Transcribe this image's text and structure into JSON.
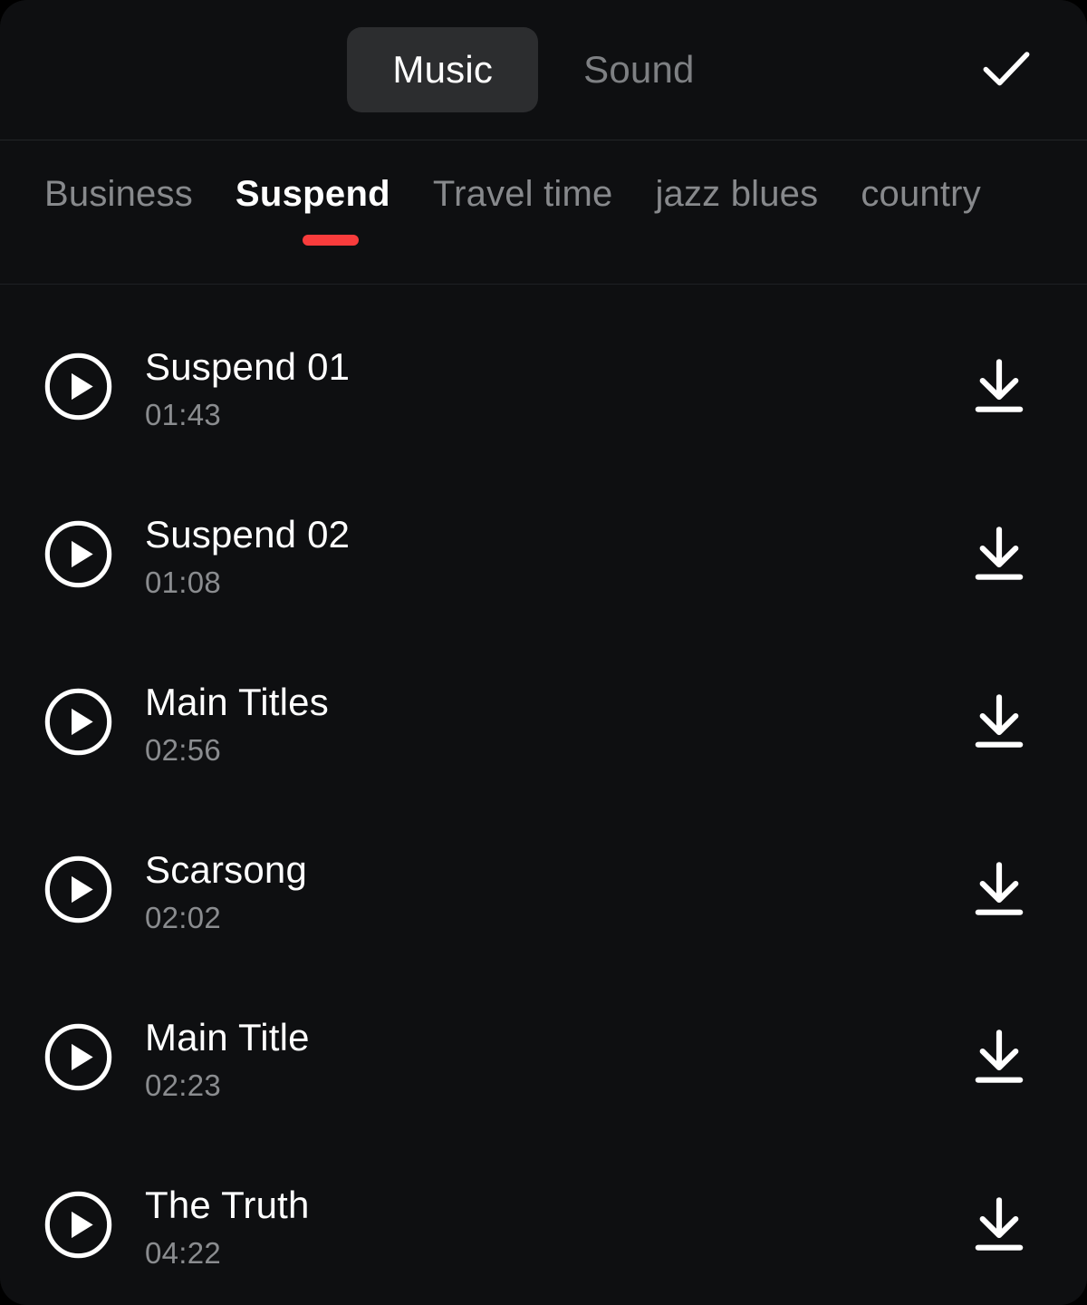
{
  "header": {
    "modes": [
      {
        "label": "Music",
        "active": true
      },
      {
        "label": "Sound",
        "active": false
      }
    ],
    "confirm_icon": "check-icon"
  },
  "categories": {
    "items": [
      {
        "label": "Business",
        "active": false
      },
      {
        "label": "Suspend",
        "active": true
      },
      {
        "label": "Travel time",
        "active": false
      },
      {
        "label": "jazz blues",
        "active": false
      },
      {
        "label": "country",
        "active": false
      }
    ],
    "indicator_color": "#f93c3c"
  },
  "tracks": [
    {
      "title": "Suspend 01",
      "duration": "01:43",
      "play_icon": "play-circle-icon",
      "download_icon": "download-icon"
    },
    {
      "title": "Suspend 02",
      "duration": "01:08",
      "play_icon": "play-circle-icon",
      "download_icon": "download-icon"
    },
    {
      "title": "Main Titles",
      "duration": "02:56",
      "play_icon": "play-circle-icon",
      "download_icon": "download-icon"
    },
    {
      "title": "Scarsong",
      "duration": "02:02",
      "play_icon": "play-circle-icon",
      "download_icon": "download-icon"
    },
    {
      "title": "Main Title",
      "duration": "02:23",
      "play_icon": "play-circle-icon",
      "download_icon": "download-icon"
    },
    {
      "title": "The Truth",
      "duration": "04:22",
      "play_icon": "play-circle-icon",
      "download_icon": "download-icon"
    }
  ],
  "colors": {
    "background": "#0e0f11",
    "active_pill": "#2c2d2f",
    "text_primary": "#ffffff",
    "text_secondary": "#87898c",
    "accent": "#f93c3c"
  }
}
